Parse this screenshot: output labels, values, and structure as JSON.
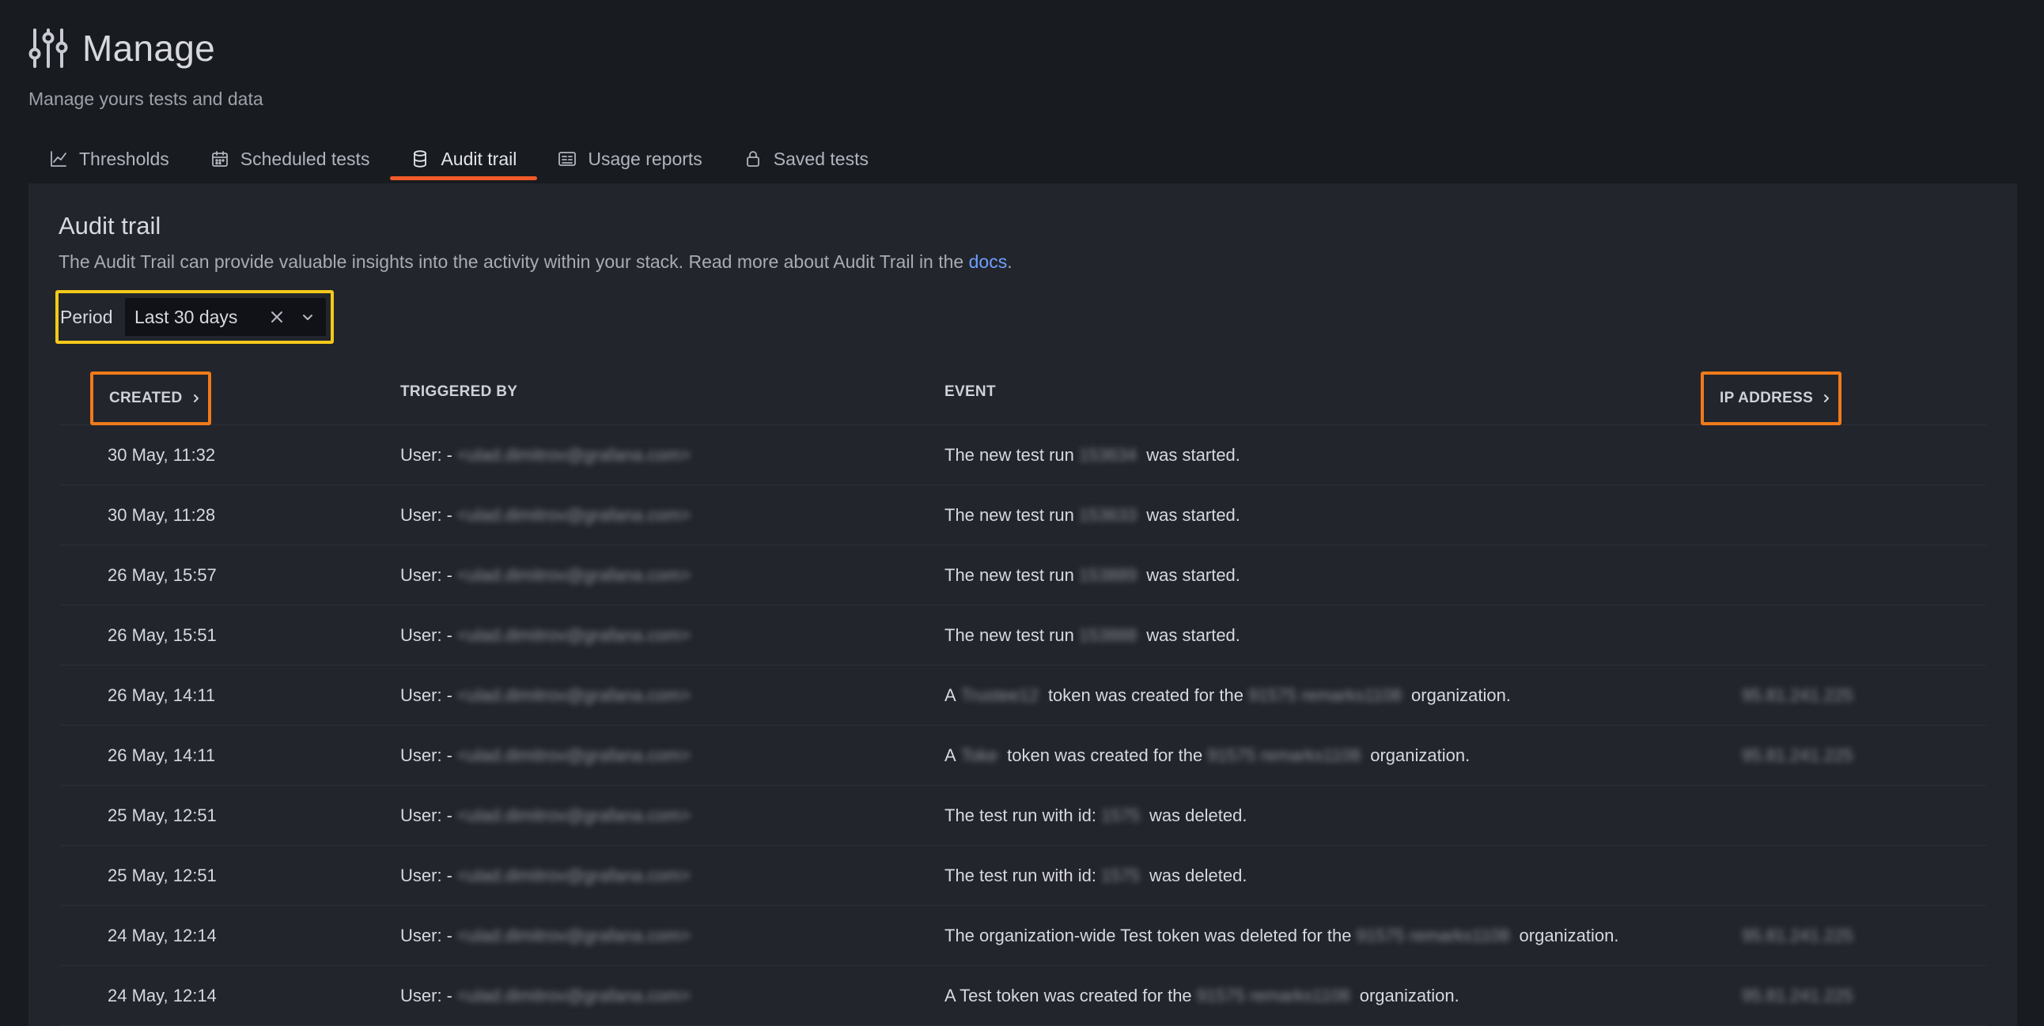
{
  "header": {
    "title": "Manage",
    "subtitle": "Manage yours tests and data"
  },
  "tabs": [
    {
      "label": "Thresholds",
      "icon": "chart-line-icon",
      "active": false
    },
    {
      "label": "Scheduled tests",
      "icon": "calendar-icon",
      "active": false
    },
    {
      "label": "Audit trail",
      "icon": "database-icon",
      "active": true
    },
    {
      "label": "Usage reports",
      "icon": "report-icon",
      "active": false
    },
    {
      "label": "Saved tests",
      "icon": "lock-icon",
      "active": false
    }
  ],
  "section": {
    "title": "Audit trail",
    "description": "The Audit Trail can provide valuable insights into the activity within your stack. Read more about Audit Trail in the",
    "docs_link": "docs",
    "description_end": "."
  },
  "period": {
    "label": "Period",
    "value": "Last 30 days"
  },
  "table": {
    "columns": [
      "CREATED",
      "TRIGGERED BY",
      "EVENT",
      "IP ADDRESS"
    ],
    "rows": [
      {
        "created": "30 May, 11:32",
        "by_prefix": "User: -",
        "by_redacted": "<ulad.dimitrov@grafana.com>",
        "event": [
          "The new test run",
          "153634",
          "was started."
        ],
        "ip": ""
      },
      {
        "created": "30 May, 11:28",
        "by_prefix": "User: -",
        "by_redacted": "<ulad.dimitrov@grafana.com>",
        "event": [
          "The new test run",
          "153633",
          "was started."
        ],
        "ip": ""
      },
      {
        "created": "26 May, 15:57",
        "by_prefix": "User: -",
        "by_redacted": "<ulad.dimitrov@grafana.com>",
        "event": [
          "The new test run",
          "153889",
          "was started."
        ],
        "ip": ""
      },
      {
        "created": "26 May, 15:51",
        "by_prefix": "User: -",
        "by_redacted": "<ulad.dimitrov@grafana.com>",
        "event": [
          "The new test run",
          "153888",
          "was started."
        ],
        "ip": ""
      },
      {
        "created": "26 May, 14:11",
        "by_prefix": "User: -",
        "by_redacted": "<ulad.dimitrov@grafana.com>",
        "event": [
          "A",
          "Trustee12",
          "token was created for the",
          "91575 remarks1108",
          "organization."
        ],
        "ip": "95.81.241.225"
      },
      {
        "created": "26 May, 14:11",
        "by_prefix": "User: -",
        "by_redacted": "<ulad.dimitrov@grafana.com>",
        "event": [
          "A",
          "Toke",
          "token was created for the",
          "91575 remarks1108",
          "organization."
        ],
        "ip": "95.81.241.225"
      },
      {
        "created": "25 May, 12:51",
        "by_prefix": "User: -",
        "by_redacted": "<ulad.dimitrov@grafana.com>",
        "event": [
          "The test run with id:",
          "1575",
          "was deleted."
        ],
        "ip": ""
      },
      {
        "created": "25 May, 12:51",
        "by_prefix": "User: -",
        "by_redacted": "<ulad.dimitrov@grafana.com>",
        "event": [
          "The test run with id:",
          "1575",
          "was deleted."
        ],
        "ip": ""
      },
      {
        "created": "24 May, 12:14",
        "by_prefix": "User: -",
        "by_redacted": "<ulad.dimitrov@grafana.com>",
        "event": [
          "The organization-wide Test token was deleted for the",
          "91575 remarks1108",
          "organization."
        ],
        "ip": "95.81.241.225"
      },
      {
        "created": "24 May, 12:14",
        "by_prefix": "User: -",
        "by_redacted": "<ulad.dimitrov@grafana.com>",
        "event": [
          "A Test token was created for the",
          "91575 remarks1108",
          "organization."
        ],
        "ip": "95.81.241.225"
      }
    ]
  },
  "colors": {
    "background": "#181b1f",
    "panel": "#22252b",
    "active_tab_underline": "#f05a28",
    "period_highlight": "#f4c91b",
    "column_highlight": "#f07a1a",
    "link": "#6e9fff"
  }
}
